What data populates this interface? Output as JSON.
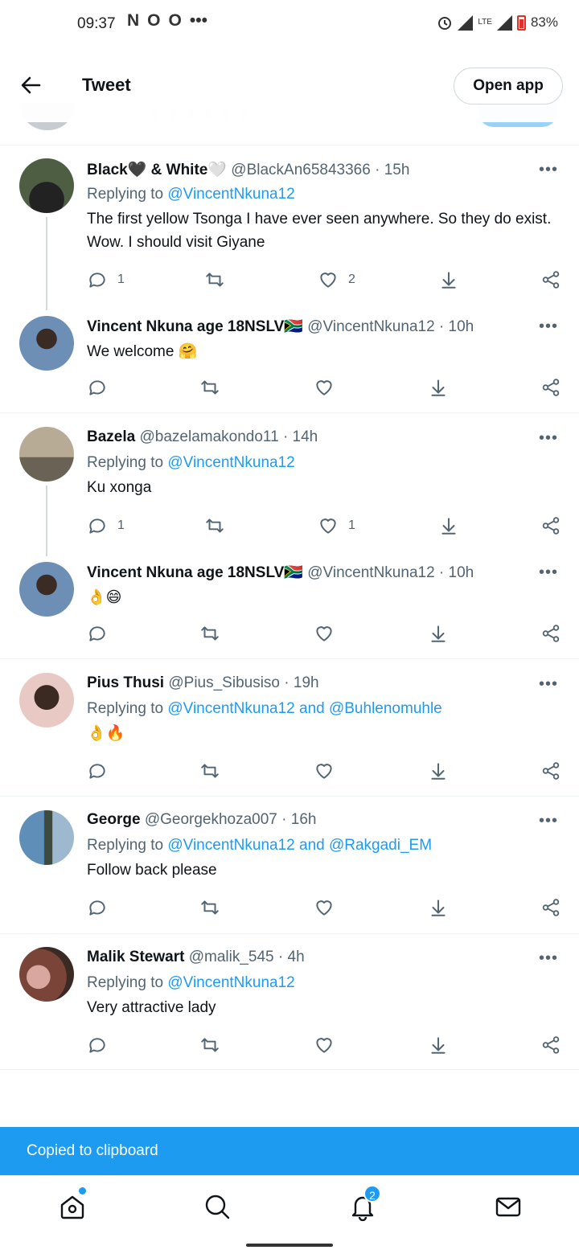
{
  "status_bar": {
    "time": "09:37",
    "left_icons": [
      "N",
      "O",
      "O",
      "•••"
    ],
    "network": "LTE",
    "battery": "83%"
  },
  "header": {
    "title": "Tweet",
    "open_app_label": "Open app"
  },
  "tweets": [
    {
      "name": "Black🖤 & White🤍",
      "handle": "@BlackAn65843366",
      "time": "· 15h",
      "replying_prefix": "Replying to ",
      "replying_to": "@VincentNkuna12",
      "text": "The first yellow Tsonga I have ever seen anywhere. So they do exist. Wow. I should visit Giyane",
      "reply_count": "1",
      "like_count": "2",
      "avatar_color": "#5a6a4a"
    },
    {
      "name": "Vincent Nkuna age 18NSLV🇿🇦",
      "handle": "@VincentNkuna12",
      "time": "· 10h",
      "text": "We welcome 🤗",
      "reply_count": "",
      "like_count": "",
      "avatar_color": "#6d8fb5"
    },
    {
      "name": "Bazela",
      "handle": "@bazelamakondo11",
      "time": "· 14h",
      "replying_prefix": "Replying to ",
      "replying_to": "@VincentNkuna12",
      "text": "Ku xonga",
      "reply_count": "1",
      "like_count": "1",
      "avatar_color": "#8a7d6a"
    },
    {
      "name": "Vincent Nkuna age 18NSLV🇿🇦",
      "handle": "@VincentNkuna12",
      "time": "· 10h",
      "text": "👌😄",
      "reply_count": "",
      "like_count": "",
      "avatar_color": "#6d8fb5"
    },
    {
      "name": "Pius Thusi",
      "handle": "@Pius_Sibusiso",
      "time": "· 19h",
      "replying_prefix": "Replying to ",
      "replying_to": "@VincentNkuna12 and @Buhlenomuhle",
      "text": "👌🔥",
      "reply_count": "",
      "like_count": "",
      "avatar_color": "#c9a08e"
    },
    {
      "name": "George",
      "handle": "@Georgekhoza007",
      "time": "· 16h",
      "replying_prefix": "Replying to ",
      "replying_to": "@VincentNkuna12 and @Rakgadi_EM",
      "text": "Follow back please",
      "reply_count": "",
      "like_count": "",
      "avatar_color": "#7a9fc0"
    },
    {
      "name": "Malik Stewart",
      "handle": "@malik_545",
      "time": "· 4h",
      "replying_prefix": "Replying to ",
      "replying_to": "@VincentNkuna12",
      "text": "Very attractive lady",
      "reply_count": "",
      "like_count": "",
      "avatar_color": "#8a5a4e"
    }
  ],
  "toast": {
    "text": "Copied to clipboard"
  },
  "bottom_nav": {
    "items": [
      "home-icon",
      "search-icon",
      "notifications-icon",
      "messages-icon"
    ],
    "notifications_badge": "2"
  },
  "colors": {
    "accent": "#1d9bf0",
    "secondary_text": "#536471"
  }
}
